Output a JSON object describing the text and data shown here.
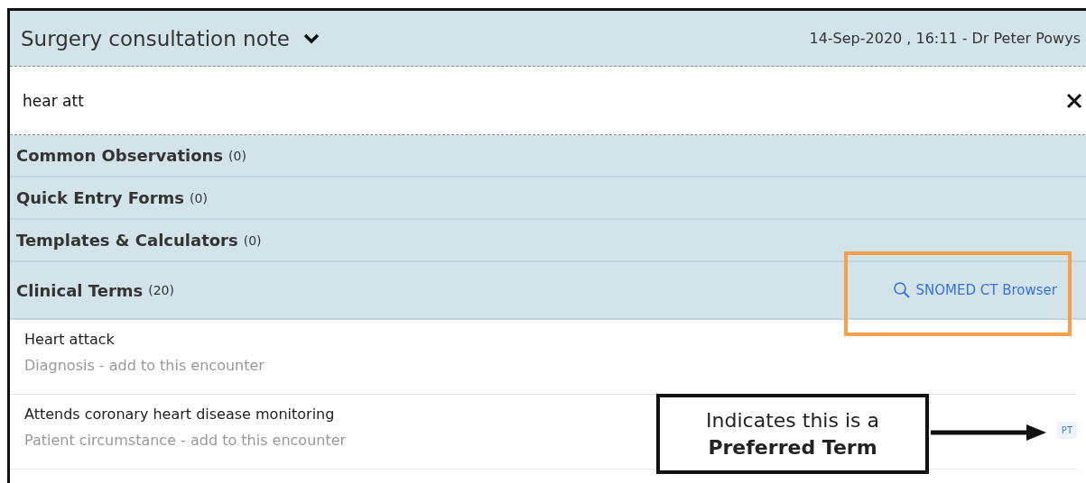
{
  "header": {
    "title": "Surgery consultation note",
    "meta": "14-Sep-2020 , 16:11 - Dr Peter Powys"
  },
  "search": {
    "value": "hear att"
  },
  "sections": [
    {
      "title": "Common Observations",
      "count": "(0)"
    },
    {
      "title": "Quick Entry Forms",
      "count": "(0)"
    },
    {
      "title": "Templates & Calculators",
      "count": "(0)"
    },
    {
      "title": "Clinical Terms",
      "count": "(20)",
      "link": "SNOMED CT Browser"
    }
  ],
  "results": [
    {
      "term": "Heart attack",
      "detail": "Diagnosis - add to this encounter"
    },
    {
      "term": "Attends coronary heart disease monitoring",
      "detail": "Patient circumstance - add to this encounter",
      "badge": "PT"
    }
  ],
  "annotations": [
    {
      "kind": "highlight"
    },
    {
      "kind": "callout",
      "text": "Indicates this is a **Preferred Term**"
    }
  ]
}
